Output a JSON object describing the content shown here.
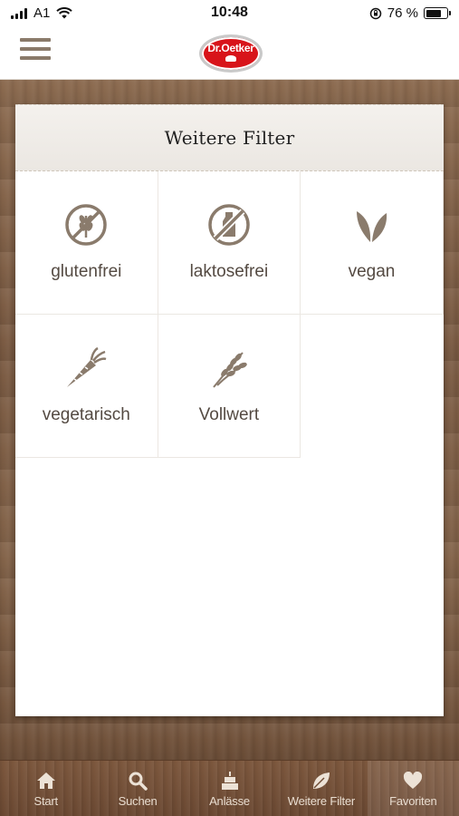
{
  "status_bar": {
    "carrier": "A1",
    "time": "10:48",
    "battery_percent_label": "76 %",
    "battery_level": 0.76
  },
  "header": {
    "brand_logo_text": "Dr.Oetker",
    "brand_color": "#d8141a"
  },
  "panel": {
    "title": "Weitere Filter",
    "filters": [
      {
        "label": "glutenfrei",
        "icon": "no-gluten-icon"
      },
      {
        "label": "laktosefrei",
        "icon": "no-lactose-icon"
      },
      {
        "label": "vegan",
        "icon": "leaf-icon"
      },
      {
        "label": "vegetarisch",
        "icon": "carrot-icon"
      },
      {
        "label": "Vollwert",
        "icon": "wheat-icon"
      }
    ]
  },
  "tabbar": {
    "tabs": [
      {
        "label": "Start",
        "icon": "home-icon"
      },
      {
        "label": "Suchen",
        "icon": "search-icon"
      },
      {
        "label": "Anlässe",
        "icon": "cake-icon"
      },
      {
        "label": "Weitere Filter",
        "icon": "leaf-icon"
      },
      {
        "label": "Favoriten",
        "icon": "heart-icon",
        "active": true
      }
    ]
  },
  "colors": {
    "icon": "#8a7b6c",
    "tab_text": "#e9ddd0",
    "wood": "#7a5a42"
  }
}
